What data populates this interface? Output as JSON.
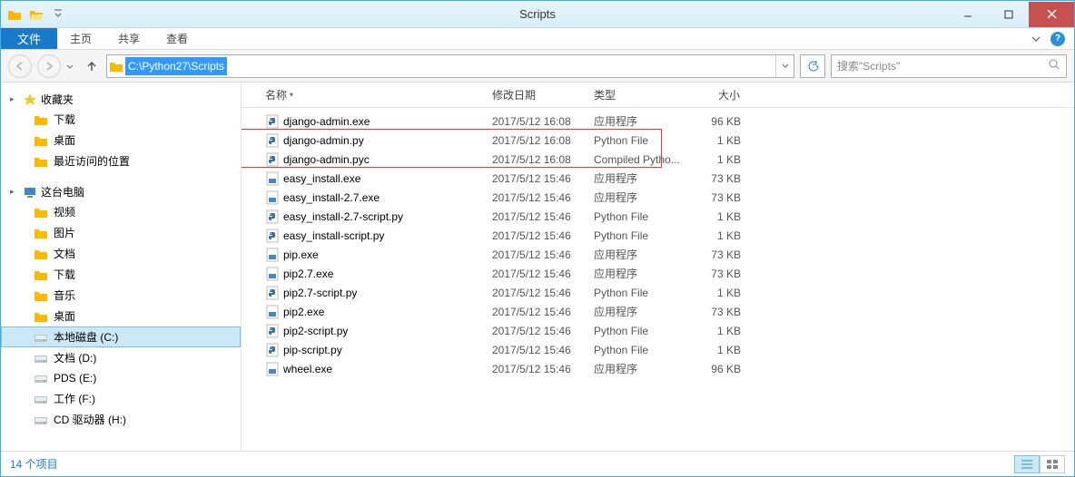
{
  "window": {
    "title": "Scripts"
  },
  "ribbon": {
    "file": "文件",
    "tabs": [
      "主页",
      "共享",
      "查看"
    ]
  },
  "address": {
    "path": "C:\\Python27\\Scripts",
    "search_placeholder": "搜索\"Scripts\""
  },
  "nav": {
    "favorites": {
      "label": "收藏夹",
      "items": [
        "下载",
        "桌面",
        "最近访问的位置"
      ]
    },
    "thispc": {
      "label": "这台电脑",
      "items": [
        "视频",
        "图片",
        "文档",
        "下载",
        "音乐",
        "桌面",
        "本地磁盘 (C:)",
        "文档 (D:)",
        "PDS (E:)",
        "工作 (F:)",
        "CD 驱动器 (H:)"
      ],
      "selected": "本地磁盘 (C:)"
    }
  },
  "columns": {
    "name": "名称",
    "date": "修改日期",
    "type": "类型",
    "size": "大小"
  },
  "files": [
    {
      "name": "django-admin.exe",
      "date": "2017/5/12 16:08",
      "type": "应用程序",
      "size": "96 KB",
      "icon": "py-exe"
    },
    {
      "name": "django-admin.py",
      "date": "2017/5/12 16:08",
      "type": "Python File",
      "size": "1 KB",
      "icon": "py"
    },
    {
      "name": "django-admin.pyc",
      "date": "2017/5/12 16:08",
      "type": "Compiled Pytho...",
      "size": "1 KB",
      "icon": "py"
    },
    {
      "name": "easy_install.exe",
      "date": "2017/5/12 15:46",
      "type": "应用程序",
      "size": "73 KB",
      "icon": "exe"
    },
    {
      "name": "easy_install-2.7.exe",
      "date": "2017/5/12 15:46",
      "type": "应用程序",
      "size": "73 KB",
      "icon": "exe"
    },
    {
      "name": "easy_install-2.7-script.py",
      "date": "2017/5/12 15:46",
      "type": "Python File",
      "size": "1 KB",
      "icon": "py"
    },
    {
      "name": "easy_install-script.py",
      "date": "2017/5/12 15:46",
      "type": "Python File",
      "size": "1 KB",
      "icon": "py"
    },
    {
      "name": "pip.exe",
      "date": "2017/5/12 15:46",
      "type": "应用程序",
      "size": "73 KB",
      "icon": "exe"
    },
    {
      "name": "pip2.7.exe",
      "date": "2017/5/12 15:46",
      "type": "应用程序",
      "size": "73 KB",
      "icon": "exe"
    },
    {
      "name": "pip2.7-script.py",
      "date": "2017/5/12 15:46",
      "type": "Python File",
      "size": "1 KB",
      "icon": "py"
    },
    {
      "name": "pip2.exe",
      "date": "2017/5/12 15:46",
      "type": "应用程序",
      "size": "73 KB",
      "icon": "exe"
    },
    {
      "name": "pip2-script.py",
      "date": "2017/5/12 15:46",
      "type": "Python File",
      "size": "1 KB",
      "icon": "py"
    },
    {
      "name": "pip-script.py",
      "date": "2017/5/12 15:46",
      "type": "Python File",
      "size": "1 KB",
      "icon": "py"
    },
    {
      "name": "wheel.exe",
      "date": "2017/5/12 15:46",
      "type": "应用程序",
      "size": "96 KB",
      "icon": "exe"
    }
  ],
  "statusbar": {
    "count": "14 个项目"
  },
  "highlight": {
    "covers": [
      "django-admin.py",
      "django-admin.pyc"
    ]
  }
}
